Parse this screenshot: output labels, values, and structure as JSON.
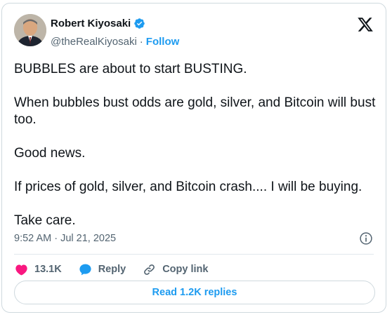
{
  "author": {
    "name": "Robert Kiyosaki",
    "handle": "@theRealKiyosaki",
    "separator": "·",
    "follow_label": "Follow",
    "verified_color": "#1d9bf0"
  },
  "tweet": {
    "paragraphs": [
      "BUBBLES are about to start BUSTING.",
      "When bubbles bust odds are gold, silver, and Bitcoin will bust too.",
      "Good news.",
      "If prices of gold, silver, and Bitcoin crash.... I will be buying.",
      "Take care."
    ],
    "timestamp": "9:52 AM · Jul 21, 2025"
  },
  "actions": {
    "likes_count": "13.1K",
    "reply_label": "Reply",
    "copy_link_label": "Copy link"
  },
  "replies_button_label": "Read 1.2K replies",
  "icons": {
    "logo": "x-logo-icon",
    "like": "heart-icon",
    "reply": "chat-bubble-icon",
    "copy": "link-icon",
    "info": "info-icon"
  },
  "colors": {
    "accent": "#1d9bf0",
    "like": "#f91880",
    "text": "#0f1419",
    "muted": "#536471"
  }
}
